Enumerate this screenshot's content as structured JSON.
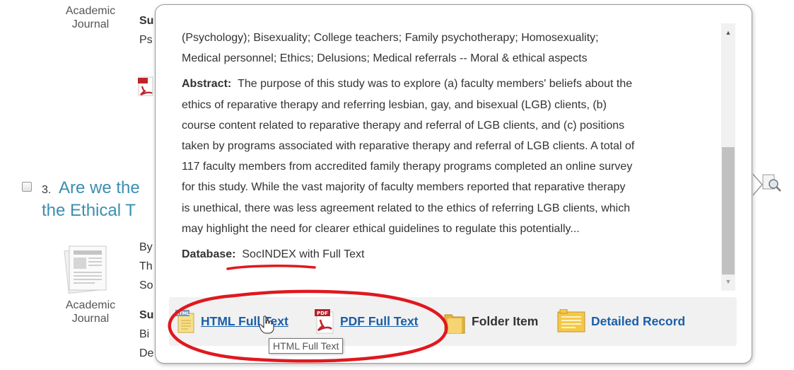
{
  "results": {
    "item2": {
      "pubtype_label": "Academic\nJournal",
      "subjects_fragment": "Su",
      "line_fragment": "Ps"
    },
    "item3": {
      "number": "3.",
      "title_line1": "Are we the",
      "title_line2": "the Ethical T",
      "line1": "By",
      "line2": "Th",
      "line3": "So",
      "pubtype_label": "Academic\nJournal",
      "subjects_fragment": "Su",
      "line4": "Bi",
      "line5": "De"
    }
  },
  "popup": {
    "subjects_text": "(Psychology); Bisexuality; College teachers; Family psychotherapy; Homosexuality;",
    "subjects_text_2": "Medical personnel; Ethics; Delusions; Medical referrals -- Moral & ethical aspects",
    "abstract_label": "Abstract:",
    "abstract_lines": [
      "The purpose of this study was to explore (a) faculty members' beliefs about the",
      "ethics of reparative therapy and referring lesbian, gay, and bisexual (LGB) clients, (b)",
      "course content related to reparative therapy and referral of LGB clients, and (c) positions",
      "taken by programs associated with reparative therapy and referral of LGB clients. A total of",
      "117 faculty members from accredited family therapy programs completed an online survey",
      "for this study. While the vast majority of faculty members reported that reparative therapy",
      "is unethical, there was less agreement related to the ethics of referring LGB clients, which",
      "may highlight the need for clearer ethical guidelines to regulate this potentially..."
    ],
    "database_label": "Database:",
    "database_value": "SocINDEX with Full Text",
    "actions": {
      "html_full_text": "HTML Full Text",
      "pdf_full_text": "PDF Full Text",
      "folder_item": "Folder Item",
      "detailed_record": "Detailed Record"
    },
    "tooltip": "HTML Full Text",
    "html_icon_badge": "HTML",
    "pdf_icon_badge": "PDF"
  },
  "colors": {
    "link": "#1b5fa8",
    "result_title": "#3a8fb0",
    "annotation": "#e0181e"
  },
  "icons": [
    "html-full-text-icon",
    "pdf-full-text-icon",
    "folder-icon",
    "detailed-record-icon",
    "magnifier-icon",
    "document-thumbnail-icon",
    "pdf-icon",
    "hand-cursor-icon"
  ]
}
